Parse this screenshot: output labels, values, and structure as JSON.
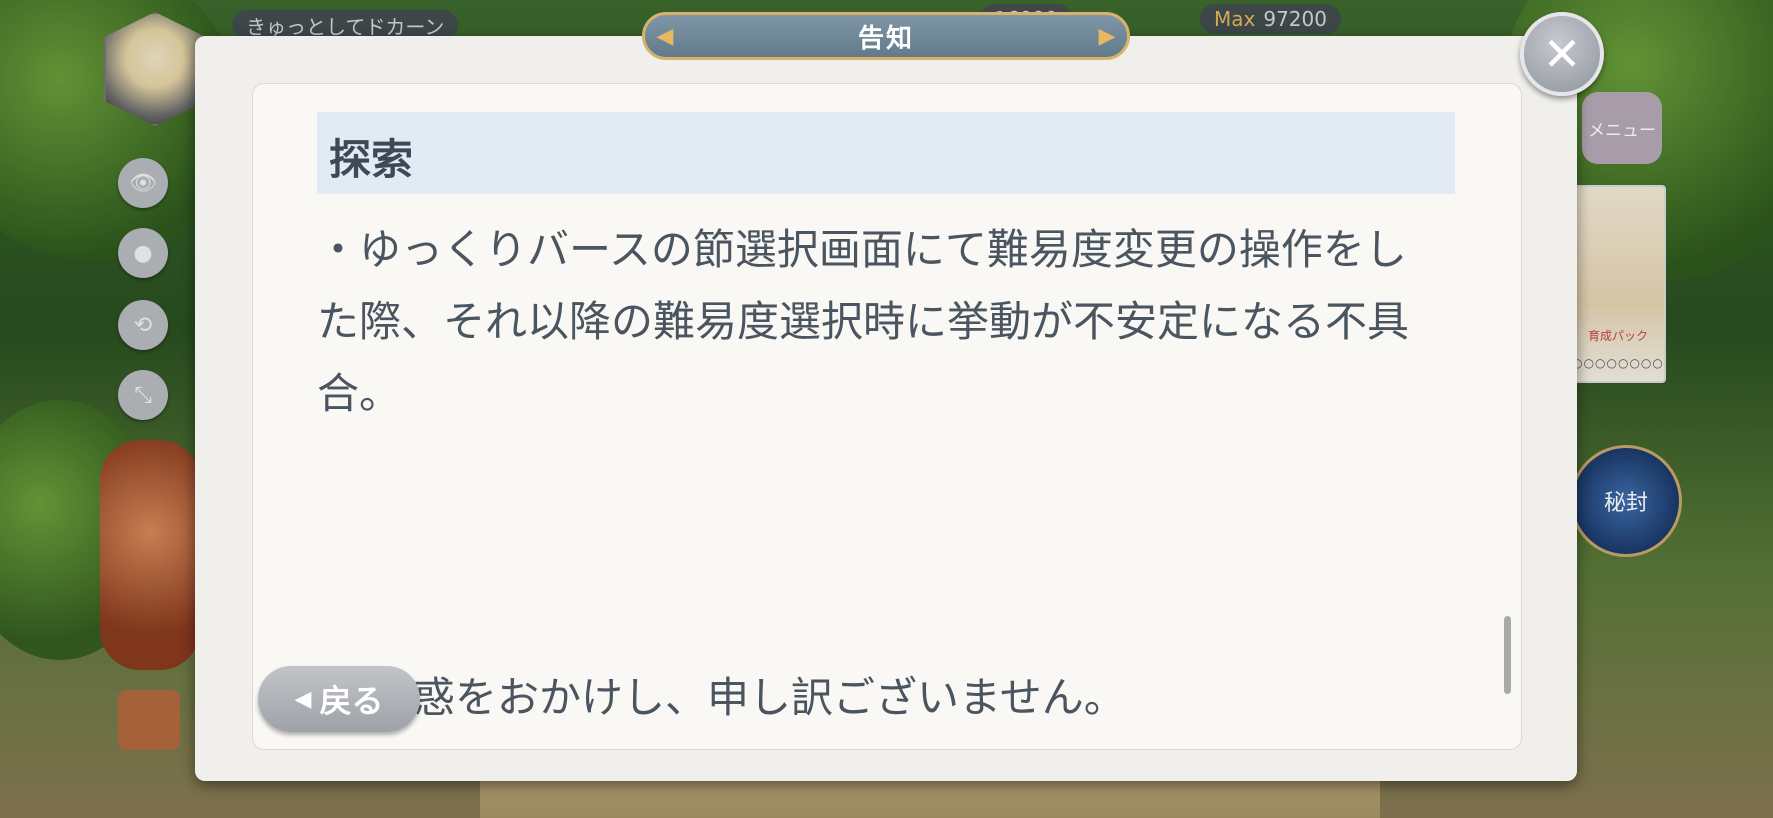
{
  "background": {
    "player_name": "きゅっとしてドカーン",
    "currency_max_1": "16000",
    "currency_max_2_label": "Max",
    "currency_max_2": "97200",
    "menu_label": "メニュー",
    "pack_label": "育成パック",
    "pack_dots": "○○○○○○○○",
    "seal_label": "秘封"
  },
  "modal": {
    "title": "告知",
    "close_symbol": "✕",
    "section_heading": "探索",
    "body": "・ゆっくりバースの節選択画面にて難易度変更の操作をした際、それ以降の難易度選択時に挙動が不安定になる不具合。",
    "bottom_line": "惑をおかけし、申し訳ございません。",
    "back_label": "戻る"
  },
  "icons": {
    "eye": "👁",
    "reload": "⟲",
    "shrink": "⤡"
  }
}
